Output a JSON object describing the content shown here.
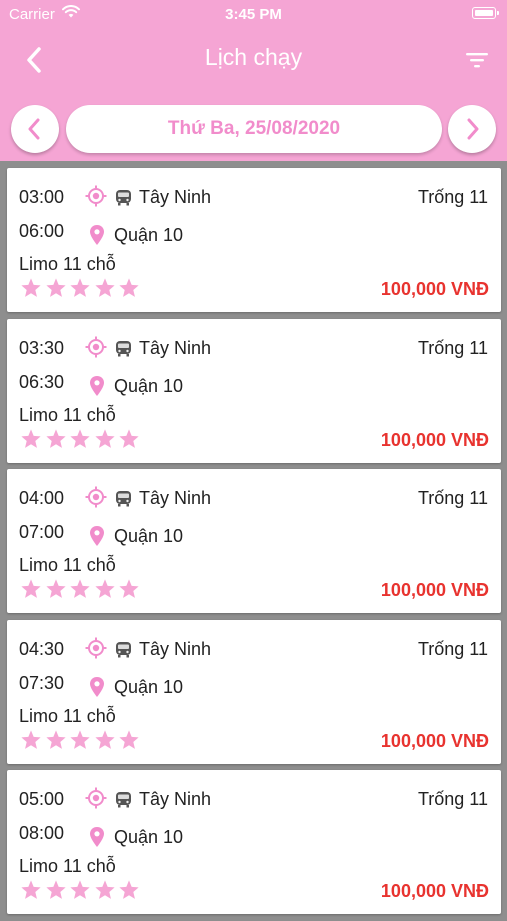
{
  "status_bar": {
    "carrier": "Carrier",
    "time": "3:45 PM"
  },
  "nav": {
    "title": "Lịch chạy",
    "back_icon": "chevron-left-icon",
    "filter_icon": "filter-icon"
  },
  "date_bar": {
    "date": "Thứ Ba, 25/08/2020",
    "prev_icon": "chevron-left-icon",
    "next_icon": "chevron-right-icon"
  },
  "colors": {
    "header": "#f5a5d4",
    "accent_pink": "#f18ccb",
    "price": "#e8332f",
    "background": "#8e8e8e"
  },
  "trips": [
    {
      "depart": "03:00",
      "arrive": "06:00",
      "from": "Tây Ninh",
      "to": "Quận 10",
      "seats": "Trống 11",
      "vehicle": "Limo 11 chỗ",
      "rating": 5,
      "price": "100,000 VNĐ"
    },
    {
      "depart": "03:30",
      "arrive": "06:30",
      "from": "Tây Ninh",
      "to": "Quận 10",
      "seats": "Trống 11",
      "vehicle": "Limo 11 chỗ",
      "rating": 5,
      "price": "100,000 VNĐ"
    },
    {
      "depart": "04:00",
      "arrive": "07:00",
      "from": "Tây Ninh",
      "to": "Quận 10",
      "seats": "Trống 11",
      "vehicle": "Limo 11 chỗ",
      "rating": 5,
      "price": "100,000 VNĐ"
    },
    {
      "depart": "04:30",
      "arrive": "07:30",
      "from": "Tây Ninh",
      "to": "Quận 10",
      "seats": "Trống 11",
      "vehicle": "Limo 11 chỗ",
      "rating": 5,
      "price": "100,000 VNĐ"
    },
    {
      "depart": "05:00",
      "arrive": "08:00",
      "from": "Tây Ninh",
      "to": "Quận 10",
      "seats": "Trống 11",
      "vehicle": "Limo 11 chỗ",
      "rating": 5,
      "price": "100,000 VNĐ"
    }
  ]
}
